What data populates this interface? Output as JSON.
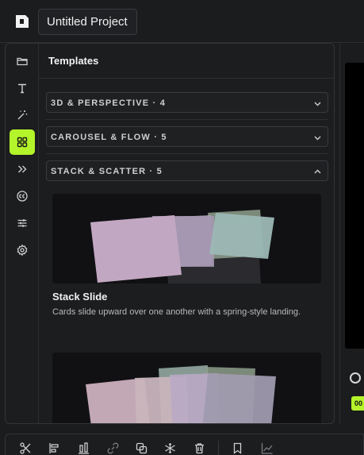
{
  "header": {
    "project_title": "Untitled Project"
  },
  "sidebar": {
    "items": [
      {
        "name": "folder-icon",
        "active": false
      },
      {
        "name": "text-icon",
        "active": false
      },
      {
        "name": "magic-wand-icon",
        "active": false
      },
      {
        "name": "grid-icon",
        "active": true
      },
      {
        "name": "double-chevron-right-icon",
        "active": false
      },
      {
        "name": "captions-icon",
        "active": false
      },
      {
        "name": "sliders-icon",
        "active": false
      },
      {
        "name": "gear-icon",
        "active": false
      }
    ]
  },
  "templates": {
    "title": "Templates",
    "categories": [
      {
        "label": "3D & PERSPECTIVE · 4",
        "expanded": false
      },
      {
        "label": "CAROUSEL & FLOW · 5",
        "expanded": false
      },
      {
        "label": "STACK & SCATTER · 5",
        "expanded": true
      }
    ],
    "cards": [
      {
        "title": "Stack Slide",
        "description": "Cards slide upward over one another with a spring-style landing."
      }
    ]
  },
  "preview": {
    "badge_text": "00"
  },
  "toolbar": {
    "tools": [
      "split-icon",
      "align-left-icon",
      "align-bottom-icon",
      "link-icon",
      "duplicate-icon",
      "freeze-icon",
      "trash-icon",
      "bookmark-icon",
      "graph-icon"
    ]
  },
  "colors": {
    "accent": "#b4f42a",
    "background": "#1b1c1e",
    "panel": "#1c1d1f"
  }
}
